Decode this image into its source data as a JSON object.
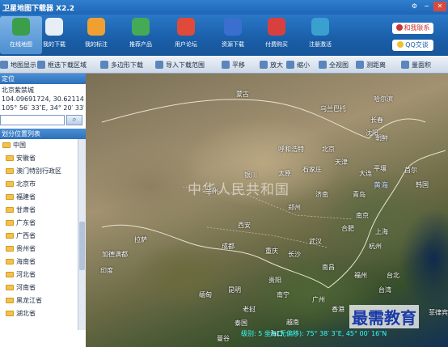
{
  "window": {
    "title": "卫星地图下载器 X2.2"
  },
  "ribbon": {
    "buttons": [
      {
        "label": "在线地图",
        "icon": "globe-icon",
        "color": "#3b9e4a"
      },
      {
        "label": "我的下载",
        "icon": "download-list-icon",
        "color": "#e8eef5"
      },
      {
        "label": "我的标注",
        "icon": "map-pin-icon",
        "color": "#f0a030"
      },
      {
        "label": "推荐产品",
        "icon": "product-blocks-icon",
        "color": "#44aa55"
      },
      {
        "label": "用户论坛",
        "icon": "users-forum-icon",
        "color": "#e04a3a"
      },
      {
        "label": "资源下载",
        "icon": "resource-download-icon",
        "color": "#3a6fd0"
      },
      {
        "label": "付费购买",
        "icon": "shopping-cart-icon",
        "color": "#d84040"
      },
      {
        "label": "注册激活",
        "icon": "register-activate-icon",
        "color": "#3aa0d0"
      }
    ],
    "contact_label": "和我联系",
    "qq_label": "QQ交谈"
  },
  "toolbar": {
    "items": [
      {
        "label": "地图显示 ▾",
        "icon": "layers-icon"
      },
      {
        "label": "框选下载区域",
        "icon": "rect-select-icon"
      },
      {
        "label": "多边形下载",
        "icon": "polygon-icon"
      },
      {
        "label": "导入下载范围",
        "icon": "import-icon"
      },
      {
        "label": "平移",
        "icon": "pan-icon"
      },
      {
        "label": "放大",
        "icon": "zoom-in-icon"
      },
      {
        "label": "缩小",
        "icon": "zoom-out-icon"
      },
      {
        "label": "全视图",
        "icon": "full-view-icon"
      },
      {
        "label": "测距离",
        "icon": "ruler-icon"
      },
      {
        "label": "量面积",
        "icon": "area-icon"
      }
    ]
  },
  "left_panel": {
    "locate_header": "定位",
    "place_name": "北京紫禁城",
    "coords_decimal": "104.09691724, 30.62114865",
    "coords_dms": "105° 56′ 33″E, 34° 20′ 33″N",
    "search_placeholder": "",
    "list_header": "划分位置列表",
    "tree_root": "中国",
    "tree_items": [
      "安徽省",
      "澳门特别行政区",
      "北京市",
      "福建省",
      "甘肃省",
      "广东省",
      "广西省",
      "贵州省",
      "海南省",
      "河北省",
      "河南省",
      "黑龙江省",
      "湖北省"
    ]
  },
  "map": {
    "labels": [
      {
        "text": "中华人民共和国",
        "cls": "big"
      },
      {
        "text": "蒙古",
        "cls": ""
      },
      {
        "text": "北京",
        "cls": ""
      },
      {
        "text": "天津",
        "cls": ""
      },
      {
        "text": "太原",
        "cls": ""
      },
      {
        "text": "石家庄",
        "cls": ""
      },
      {
        "text": "济南",
        "cls": ""
      },
      {
        "text": "郑州",
        "cls": ""
      },
      {
        "text": "西安",
        "cls": ""
      },
      {
        "text": "兰州",
        "cls": ""
      },
      {
        "text": "银川",
        "cls": ""
      },
      {
        "text": "呼和浩特",
        "cls": ""
      },
      {
        "text": "合肥",
        "cls": ""
      },
      {
        "text": "南京",
        "cls": ""
      },
      {
        "text": "上海",
        "cls": ""
      },
      {
        "text": "杭州",
        "cls": ""
      },
      {
        "text": "武汉",
        "cls": ""
      },
      {
        "text": "南昌",
        "cls": ""
      },
      {
        "text": "长沙",
        "cls": ""
      },
      {
        "text": "福州",
        "cls": ""
      },
      {
        "text": "台北",
        "cls": ""
      },
      {
        "text": "台湾",
        "cls": ""
      },
      {
        "text": "广州",
        "cls": ""
      },
      {
        "text": "南宁",
        "cls": ""
      },
      {
        "text": "昆明",
        "cls": ""
      },
      {
        "text": "贵阳",
        "cls": ""
      },
      {
        "text": "重庆",
        "cls": ""
      },
      {
        "text": "成都",
        "cls": ""
      },
      {
        "text": "拉萨",
        "cls": ""
      },
      {
        "text": "加德满都",
        "cls": ""
      },
      {
        "text": "印度",
        "cls": ""
      },
      {
        "text": "缅甸",
        "cls": ""
      },
      {
        "text": "老挝",
        "cls": ""
      },
      {
        "text": "泰国",
        "cls": ""
      },
      {
        "text": "越南",
        "cls": ""
      },
      {
        "text": "曼谷",
        "cls": ""
      },
      {
        "text": "菲律宾",
        "cls": ""
      },
      {
        "text": "首尔",
        "cls": ""
      },
      {
        "text": "平壤",
        "cls": ""
      },
      {
        "text": "韩国",
        "cls": ""
      },
      {
        "text": "朝鲜",
        "cls": ""
      },
      {
        "text": "黄海",
        "cls": "sea"
      },
      {
        "text": "沈阳",
        "cls": ""
      },
      {
        "text": "长春",
        "cls": ""
      },
      {
        "text": "哈尔滨",
        "cls": ""
      },
      {
        "text": "大连",
        "cls": ""
      },
      {
        "text": "青岛",
        "cls": ""
      },
      {
        "text": "乌兰巴托",
        "cls": ""
      },
      {
        "text": "海口",
        "cls": ""
      },
      {
        "text": "香港",
        "cls": ""
      }
    ],
    "status": "级别: 5   坐标(无偏移): 75° 38′ 3″E, 45° 00′ 16″N",
    "watermark": "最需教育"
  }
}
